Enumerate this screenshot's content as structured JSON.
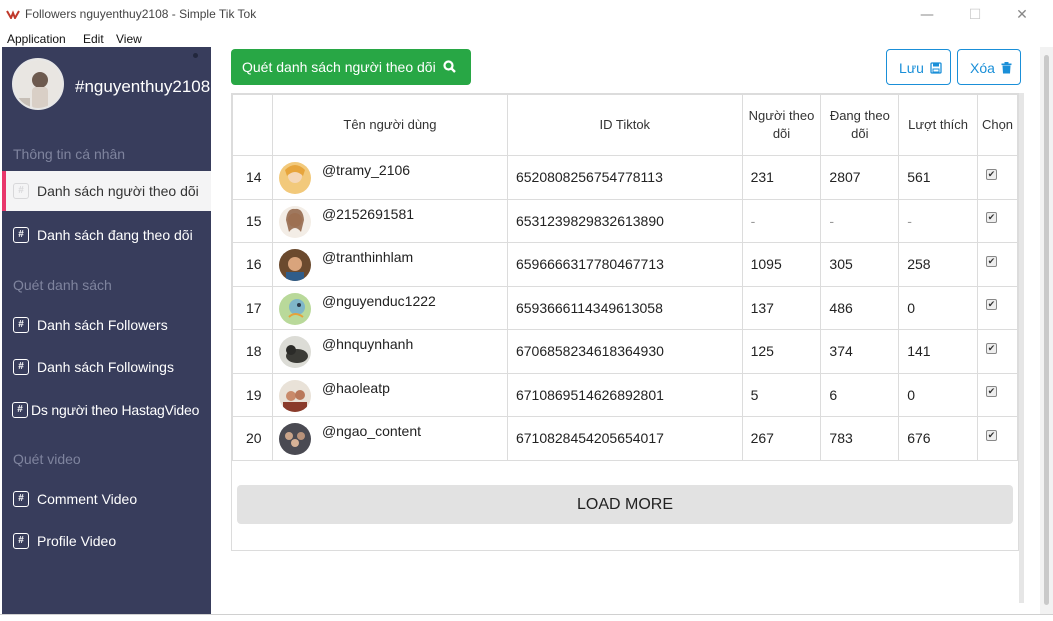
{
  "window": {
    "title": "Followers nguyenthuy2108 - Simple Tik Tok",
    "controls": {
      "minimize": "—",
      "maximize": "☐",
      "close": "✕"
    }
  },
  "menu": [
    "Application",
    "Edit",
    "View"
  ],
  "sidebar": {
    "username": "#nguyenthuy2108",
    "sections": {
      "personal": "Thông tin cá nhân",
      "scan_list": "Quét danh sách",
      "scan_video": "Quét video"
    },
    "items": [
      {
        "label": "Danh sách người theo dõi",
        "active": true
      },
      {
        "label": "Danh sách đang theo dõi",
        "active": false
      },
      {
        "label": "Danh sách Followers",
        "active": false
      },
      {
        "label": "Danh sách Followings",
        "active": false
      },
      {
        "label": "Ds người theo HastagVideo",
        "active": false
      },
      {
        "label": "Comment Video",
        "active": false
      },
      {
        "label": "Profile Video",
        "active": false
      }
    ],
    "nav_icon_glyph": "#"
  },
  "toolbar": {
    "scan_button": "Quét danh sách người theo dõi",
    "save_button": "Lưu",
    "delete_button": "Xóa"
  },
  "table": {
    "headers": {
      "index": "",
      "username": "Tên người dùng",
      "tiktok_id": "ID Tiktok",
      "followers": "Người theo dõi",
      "following": "Đang theo dõi",
      "likes": "Lượt thích",
      "select": "Chọn"
    },
    "rows": [
      {
        "index": "14",
        "username": "@tramy_2106",
        "tiktok_id": "6520808256754778113",
        "followers": "231",
        "following": "2807",
        "likes": "561",
        "checked": true
      },
      {
        "index": "15",
        "username": "@2152691581",
        "tiktok_id": "6531239829832613890",
        "followers": "-",
        "following": "-",
        "likes": "-",
        "checked": true
      },
      {
        "index": "16",
        "username": "@tranthinhlam",
        "tiktok_id": "6596666317780467713",
        "followers": "1095",
        "following": "305",
        "likes": "258",
        "checked": true
      },
      {
        "index": "17",
        "username": "@nguyenduc1222",
        "tiktok_id": "6593666114349613058",
        "followers": "137",
        "following": "486",
        "likes": "0",
        "checked": true
      },
      {
        "index": "18",
        "username": "@hnquynhanh",
        "tiktok_id": "6706858234618364930",
        "followers": "125",
        "following": "374",
        "likes": "141",
        "checked": true
      },
      {
        "index": "19",
        "username": "@haoleatp",
        "tiktok_id": "6710869514626892801",
        "followers": "5",
        "following": "6",
        "likes": "0",
        "checked": true
      },
      {
        "index": "20",
        "username": "@ngao_content",
        "tiktok_id": "6710828454205654017",
        "followers": "267",
        "following": "783",
        "likes": "676",
        "checked": true
      }
    ],
    "load_more": "LOAD MORE"
  },
  "colors": {
    "sidebar_bg": "#383d5c",
    "active_accent": "#e8376b",
    "scan_button": "#28a745",
    "outline_button": "#1a8fd8"
  }
}
